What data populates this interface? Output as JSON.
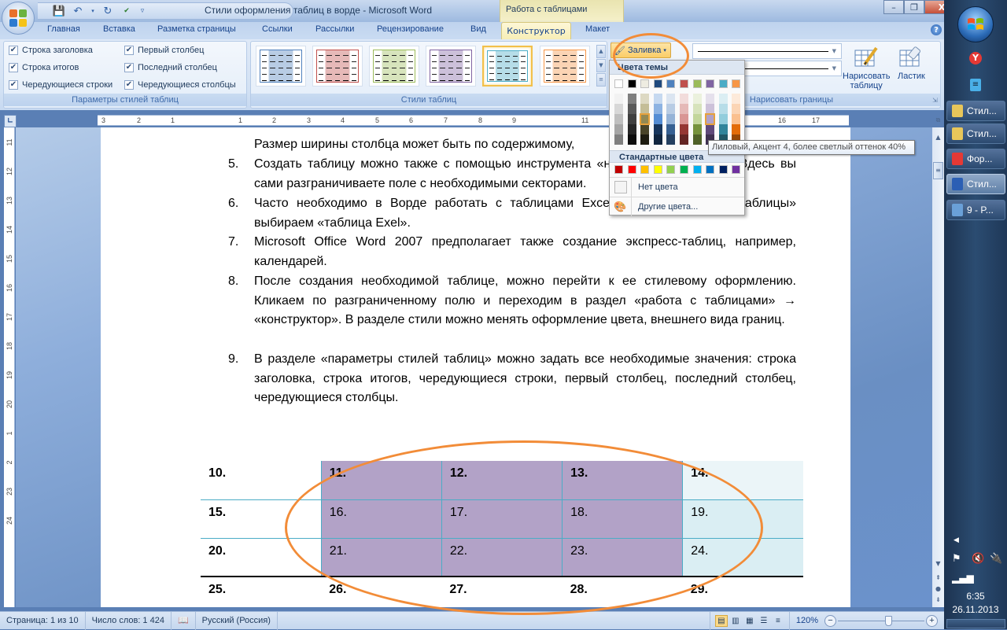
{
  "window": {
    "title": "Стили оформления таблиц в ворде - Microsoft Word",
    "context_group": "Работа с таблицами",
    "controls": {
      "minimize": "–",
      "restore": "❐",
      "close": "X"
    }
  },
  "qat": {
    "save_icon": "save-icon",
    "undo_icon": "undo-icon",
    "redo_icon": "redo-icon",
    "spell_icon": "spellcheck-icon",
    "customize": "▿"
  },
  "tabs": [
    {
      "label": "Главная"
    },
    {
      "label": "Вставка"
    },
    {
      "label": "Разметка страницы"
    },
    {
      "label": "Ссылки"
    },
    {
      "label": "Рассылки"
    },
    {
      "label": "Рецензирование"
    },
    {
      "label": "Вид"
    },
    {
      "label": "Конструктор",
      "active": true
    },
    {
      "label": "Макет"
    }
  ],
  "ribbon": {
    "style_options": {
      "label": "Параметры стилей таблиц",
      "checkboxes": [
        {
          "label": "Строка заголовка",
          "checked": true
        },
        {
          "label": "Строка итогов",
          "checked": true
        },
        {
          "label": "Чередующиеся строки",
          "checked": true
        },
        {
          "label": "Первый столбец",
          "checked": true
        },
        {
          "label": "Последний столбец",
          "checked": true
        },
        {
          "label": "Чередующиеся столбцы",
          "checked": true
        }
      ]
    },
    "table_styles": {
      "label": "Стили таблиц",
      "thumbnails": [
        {
          "accent": "#4f81bd",
          "light": "#b8cce4"
        },
        {
          "accent": "#c0504d",
          "light": "#e6b9b8"
        },
        {
          "accent": "#9bbb59",
          "light": "#d7e4bc"
        },
        {
          "accent": "#8064a2",
          "light": "#ccc0da"
        },
        {
          "accent": "#4bacc6",
          "light": "#b6dde8",
          "selected": true
        },
        {
          "accent": "#f79646",
          "light": "#fbd4b4"
        }
      ],
      "fill_button": "Заливка"
    },
    "draw_borders": {
      "label": "Нарисовать границы",
      "draw_table": "Нарисовать таблицу",
      "draw_table_l1": "Нарисовать",
      "draw_table_l2": "таблицу",
      "eraser": "Ластик"
    }
  },
  "palette": {
    "theme_header": "Цвета темы",
    "theme_top": [
      "#ffffff",
      "#000000",
      "#eeece1",
      "#1f497d",
      "#4f81bd",
      "#c0504d",
      "#9bbb59",
      "#8064a2",
      "#4bacc6",
      "#f79646"
    ],
    "theme_shades": [
      [
        "#f2f2f2",
        "#d8d8d8",
        "#bfbfbf",
        "#a5a5a5",
        "#7f7f7f"
      ],
      [
        "#7f7f7f",
        "#595959",
        "#3f3f3f",
        "#262626",
        "#0c0c0c"
      ],
      [
        "#ddd9c3",
        "#c4bd97",
        "#938953",
        "#494429",
        "#1d1b10"
      ],
      [
        "#c6d9f0",
        "#8db3e2",
        "#548dd4",
        "#17365d",
        "#0f243e"
      ],
      [
        "#dbe5f1",
        "#b8cce4",
        "#95b3d7",
        "#366092",
        "#244061"
      ],
      [
        "#f2dcdb",
        "#e5b9b7",
        "#d99694",
        "#953734",
        "#632423"
      ],
      [
        "#ebf1dd",
        "#d7e3bc",
        "#c3d69b",
        "#76923c",
        "#4f6128"
      ],
      [
        "#e5e0ec",
        "#ccc1d9",
        "#b2a2c7",
        "#5f497a",
        "#3f3151"
      ],
      [
        "#dbeef3",
        "#b7dde8",
        "#92cddc",
        "#31859b",
        "#205867"
      ],
      [
        "#fdeada",
        "#fbd5b5",
        "#fac08f",
        "#e36c09",
        "#974806"
      ]
    ],
    "selected_col": 7,
    "selected_row": 2,
    "hover_col": 2,
    "standard_header": "Стандартные цвета",
    "standard": [
      "#c00000",
      "#ff0000",
      "#ffc000",
      "#ffff00",
      "#92d050",
      "#00b050",
      "#00b0f0",
      "#0070c0",
      "#002060",
      "#7030a0"
    ],
    "no_color": "Нет цвета",
    "more_colors": "Другие цвета...",
    "tooltip": "Лиловый, Акцент 4, более светлый оттенок 40%"
  },
  "ruler": {
    "h_ticks": [
      "3",
      "2",
      "1",
      "1",
      "2",
      "3",
      "4",
      "5",
      "6",
      "7",
      "8",
      "9",
      "11",
      "16",
      "17"
    ],
    "v_ticks": [
      "11",
      "12",
      "13",
      "14",
      "15",
      "16",
      "17",
      "18",
      "19",
      "20",
      "1",
      "2",
      "23",
      "24"
    ]
  },
  "document": {
    "partial_line": "Размер ширины столбца может быть по содержимому,",
    "items": [
      {
        "num": "5.",
        "text": "Создать таблицу можно также с помощью инструмента «нарисовать таблицу». Здесь вы сами разграничиваете поле с необходимыми секторами."
      },
      {
        "num": "6.",
        "text": "Часто необходимо в Ворде работать с таблицами Excel, вкладка «вставка таблицы» выбираем «таблица Exel»."
      },
      {
        "num": "7.",
        "text": "Microsoft Office Word 2007 предполагает также создание экспресс-таблиц, например, календарей."
      },
      {
        "num": "8.",
        "text": "После создания необходимой таблице, можно перейти к ее стилевому оформлению. Кликаем по разграниченному полю и переходим в раздел «работа с таблицами» → «конструктор». В разделе стили можно менять оформление цвета, внешнего вида границ."
      },
      {
        "num": "9.",
        "text": "В разделе «параметры стилей таблиц» можно задать все необходимые значения: строка заголовка, строка итогов, чередующиеся строки, первый столбец, последний столбец, чередующиеся столбцы."
      }
    ],
    "table": {
      "rows": [
        [
          "10.",
          "11.",
          "12.",
          "13.",
          "14."
        ],
        [
          "15.",
          "16.",
          "17.",
          "18.",
          "19."
        ],
        [
          "20.",
          "21.",
          "22.",
          "23.",
          "24."
        ],
        [
          "25.",
          "26.",
          "27.",
          "28.",
          "29."
        ]
      ],
      "fill_color": "#b2a2c7",
      "last_col_color": "#daeef3",
      "border_color": "#4bacc6"
    }
  },
  "status": {
    "page": "Страница: 1 из 10",
    "words": "Число слов: 1 424",
    "language": "Русский (Россия)",
    "zoom": "120%",
    "zoom_level": 0.6
  },
  "taskbar": {
    "items": [
      {
        "label": "Стил...",
        "icon": "folder-icon",
        "color": "#e8c65a"
      },
      {
        "label": "Стил...",
        "icon": "folder-icon",
        "color": "#e8c65a"
      },
      {
        "label": "Фор...",
        "icon": "yandex-browser-icon",
        "color": "#e53935"
      },
      {
        "label": "Стил...",
        "icon": "word-icon",
        "color": "#2b5fb4",
        "active": true
      },
      {
        "label": "9 - P...",
        "icon": "paint-icon",
        "color": "#6aa0d8"
      }
    ],
    "time": "6:35",
    "date": "26.11.2013"
  }
}
